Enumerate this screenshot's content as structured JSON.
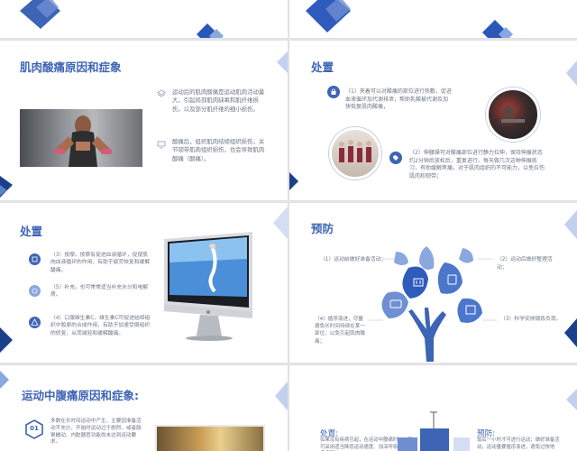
{
  "colors": {
    "accent": "#3d64b5",
    "light_accent": "#8aa7e0",
    "text": "#6d7585",
    "dark_blue": "#1c3f8c"
  },
  "slide1": {
    "title": "肌肉酸痛原因和症象",
    "item1_icon": "layers-icon",
    "item1_text": "运动后的肌肉酸痛是运动肌肉活动量大，引起局部肌肉缺氧和肌纤维损伤，以及部分肌纤维的细小损伤。",
    "item2_icon": "monitor-icon",
    "item2_text": "酸痛后，组织肌肉结缔组织损伤，关节韧带肌肉组织损伤，也会导致肌肉酸痛（酸痛）。"
  },
  "slide2": {
    "title": "处置",
    "item1_text": "（1）夹着可以对酸痛的部位进行热敷，促进血液循环加代谢排泄，帮助乳酸被代谢及加快恢复肌肉酸痛，",
    "item2_text": "（2）伸腰操可对酸痛部位进行静力拉伸，保持伸展状态约2分钟后放松后，重复进行。每天做几次这种伸展练习，有助缓解疼痛，对于肌肉组织的不可能力，以免拉伤肌肉和韧带；"
  },
  "slide3": {
    "title": "处置",
    "item1_text": "（3）按摩。按摩有促进血液循环，促使肌肉血液循环的作用，有助于疲劳恢复和缓解酸痛。",
    "item2_text": "（5）补充。也可常常适当补充水分和电解质。",
    "item3_text": "（4）口服维生素C。维生素C可促进结缔组织中胶原的合成作用，有助于加速受损组织的修复，从而减轻和缓解酸痛。"
  },
  "slide4": {
    "title": "预防",
    "label1": "（1）运动前做好准备活动；",
    "label2": "（2）运动后做好整理活动；",
    "label3": "（4）循序渐进，尽量避免长时间持续在某一部位，以免引起肌肉酸痛；",
    "label4": "（3）科学安排锻炼负荷。"
  },
  "slide5": {
    "title": "运动中腹痛原因和症象:",
    "number": "01",
    "item_text": "多数在长时间运动中产生，主要因准备活动不充分，开始时运动过于剧烈，或者肠胃蠕动、内脏器官功能尚未达到运动要求。"
  },
  "slide6": {
    "left_title": "处置:",
    "left_text": "如果没有疾病引起，在运动中腹痛时，一般可采用适当降低运动速度、加深呼吸，按压疼痛部位，",
    "right_title": "预防:",
    "right_text": "饭后一小时才可进行运动；做好准备活动，运动量要循序渐进，避免过快地"
  }
}
